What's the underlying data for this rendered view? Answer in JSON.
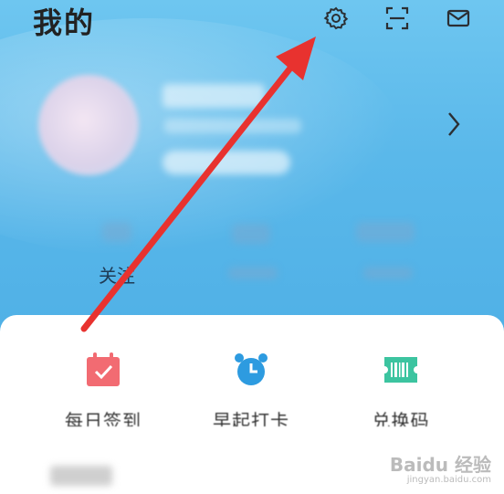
{
  "header": {
    "title": "我的",
    "icons": [
      "gear-icon",
      "scan-icon",
      "mail-icon"
    ]
  },
  "stats": {
    "follow_label": "关注"
  },
  "features": [
    {
      "icon": "calendar-check-icon",
      "label": "每日签到",
      "color": "#f26b72"
    },
    {
      "icon": "alarm-clock-icon",
      "label": "早起打卡",
      "color": "#2d9be0"
    },
    {
      "icon": "barcode-ticket-icon",
      "label": "兑换码",
      "color": "#3cc4a0"
    }
  ],
  "annotation": {
    "arrow_color": "#e8322f"
  },
  "watermark": {
    "brand": "Baidu 经验",
    "url": "jingyan.baidu.com"
  },
  "colors": {
    "hero_top": "#6ec6f0",
    "hero_bottom": "#4fb0e6",
    "card_bg": "#ffffff"
  }
}
